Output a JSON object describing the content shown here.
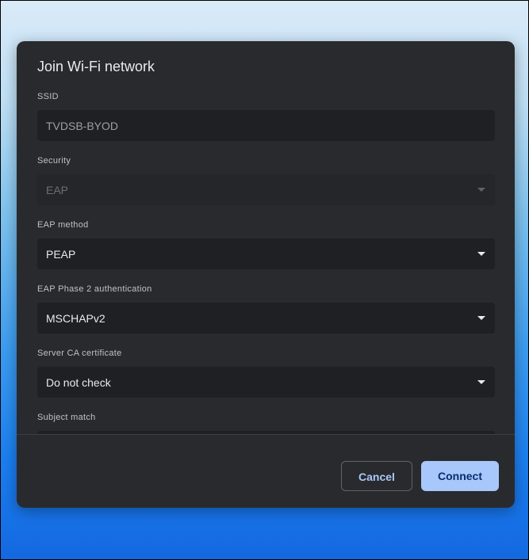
{
  "dialog": {
    "title": "Join Wi-Fi network",
    "fields": {
      "ssid": {
        "label": "SSID",
        "value": "TVDSB-BYOD"
      },
      "security": {
        "label": "Security",
        "value": "EAP"
      },
      "eap_method": {
        "label": "EAP method",
        "value": "PEAP"
      },
      "phase2": {
        "label": "EAP Phase 2 authentication",
        "value": "MSCHAPv2"
      },
      "server_ca": {
        "label": "Server CA certificate",
        "value": "Do not check"
      },
      "subject_match": {
        "label": "Subject match",
        "value": ""
      }
    },
    "buttons": {
      "cancel": "Cancel",
      "connect": "Connect"
    }
  },
  "colors": {
    "dialog_bg": "#292a2d",
    "field_bg": "#1f2023",
    "accent": "#a8c7fa",
    "text": "#e8eaed"
  }
}
